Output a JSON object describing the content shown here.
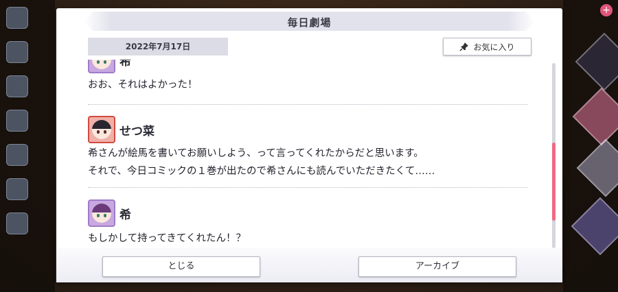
{
  "dialog": {
    "title": "毎日劇場",
    "date": "2022年7月17日",
    "favorite_label": "お気に入り"
  },
  "messages": [
    {
      "speaker": "希",
      "lines": [
        "おお、それはよかった！"
      ]
    },
    {
      "speaker": "せつ菜",
      "lines": [
        "希さんが絵馬を書いてお願いしよう、って言ってくれたからだと思います。",
        "それで、今日コミックの１巻が出たので希さんにも読んでいただきたくて……"
      ]
    },
    {
      "speaker": "希",
      "lines": [
        "もしかして持ってきてくれたん！？"
      ]
    }
  ],
  "scroll": {
    "position_fraction": 0.55
  },
  "footer": {
    "close_label": "とじる",
    "archive_label": "アーカイブ"
  },
  "icons": {
    "favorite": "pin-icon"
  },
  "colors": {
    "scroll_thumb": "#ef6a84",
    "setsuna_frame": "#d04a40",
    "nozomi_frame": "#a07ac8"
  }
}
